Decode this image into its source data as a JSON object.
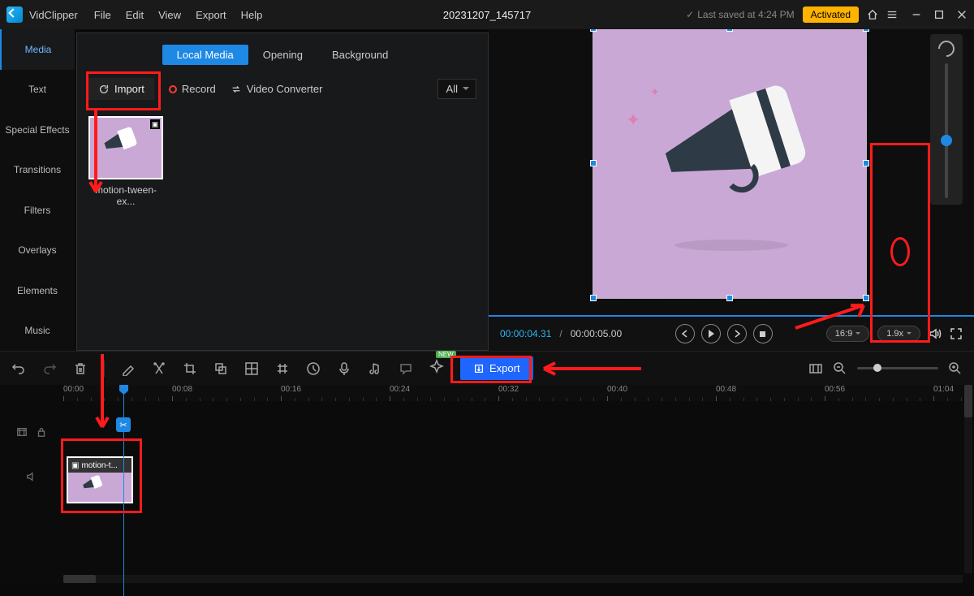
{
  "app": {
    "name": "VidClipper",
    "document": "20231207_145717"
  },
  "menu": {
    "file": "File",
    "edit": "Edit",
    "view": "View",
    "export": "Export",
    "help": "Help"
  },
  "status": {
    "saved": "Last saved at 4:24 PM",
    "activated": "Activated"
  },
  "side_tabs": {
    "media": "Media",
    "text": "Text",
    "effects": "Special Effects",
    "transitions": "Transitions",
    "filters": "Filters",
    "overlays": "Overlays",
    "elements": "Elements",
    "music": "Music"
  },
  "media_panel": {
    "tabs": {
      "local": "Local Media",
      "opening": "Opening",
      "background": "Background"
    },
    "actions": {
      "import": "Import",
      "record": "Record",
      "converter": "Video Converter"
    },
    "filter": "All",
    "items": [
      {
        "name": "motion-tween-ex..."
      }
    ]
  },
  "preview": {
    "time_current": "00:00:04.31",
    "time_duration": "00:00:05.00",
    "aspect": "16:9",
    "zoom": "1.9x"
  },
  "toolbar": {
    "export": "Export",
    "new_badge": "NEW"
  },
  "timeline": {
    "ticks": [
      "00:00",
      "00:08",
      "00:16",
      "00:24",
      "00:32",
      "00:40",
      "00:48",
      "00:56",
      "01:04"
    ],
    "clip_label": "motion-t..."
  }
}
